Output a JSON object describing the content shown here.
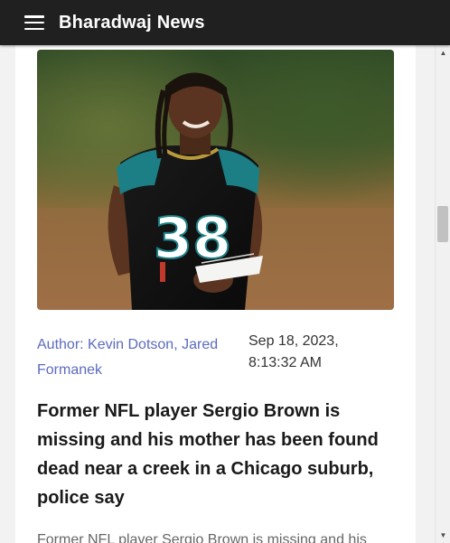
{
  "app": {
    "title": "Bharadwaj News",
    "menu_icon": "hamburger-menu-icon"
  },
  "article": {
    "image_alt": "Football player in a teal and black jersey number 38 holding papers",
    "jersey_number": "38",
    "author": "Author: Kevin Dotson, Jared Formanek",
    "published": "Sep 18, 2023, 8:13:32 AM",
    "headline": "Former NFL player Sergio Brown is missing and his mother has been found dead near a creek in a Chicago suburb, police say",
    "excerpt": "Former NFL player Sergio Brown is missing and his"
  },
  "scrollbar": {
    "up_icon": "scroll-up-arrow-icon",
    "down_icon": "scroll-down-arrow-icon",
    "up_glyph": "▲",
    "down_glyph": "▼"
  },
  "colors": {
    "appbar": "#202020",
    "author_link": "#5c6bc0",
    "card": "#ffffff",
    "page": "#f2f2f2"
  }
}
